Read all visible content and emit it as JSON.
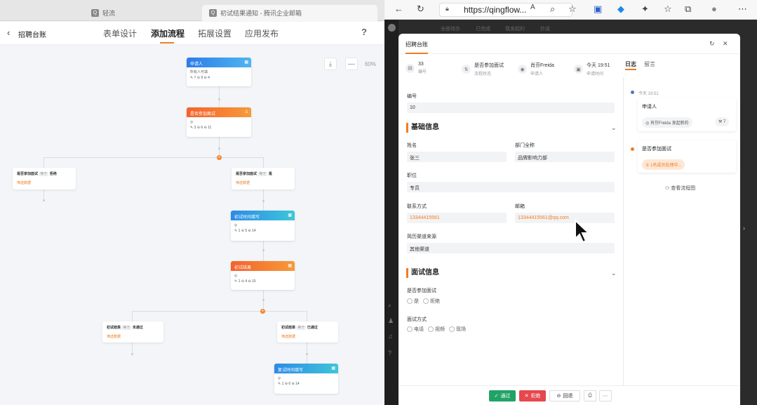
{
  "left_browser": {
    "tabs": [
      {
        "label": "轻流",
        "favicon": "Q"
      },
      {
        "label": "初试结果通知 - 腾讯企业邮箱",
        "favicon": "Q"
      }
    ]
  },
  "app": {
    "title": "招聘台账",
    "nav_tabs": [
      "表单设计",
      "添加流程",
      "拓展设置",
      "应用发布"
    ],
    "help": "?",
    "zoom": "60%"
  },
  "flow": {
    "applicant": {
      "title": "申请人",
      "body": "所有人可填",
      "meta": "7 ⊖ 9 ⊖ 4"
    },
    "interview": {
      "title": "是否参加面试",
      "meta": "3 ⊖ 6 ⊖ 11"
    },
    "cond_left": {
      "field": "是否参加面试",
      "op": "等于",
      "value": "拒绝",
      "link": "筛选数据"
    },
    "cond_right": {
      "field": "是否参加面试",
      "op": "等于",
      "value": "是",
      "link": "筛选数据"
    },
    "first_time": {
      "title": "初试时间填写",
      "meta": "1 ⊖ 5 ⊖ 14"
    },
    "first_result": {
      "title": "初试结果",
      "meta": "1 ⊖ 4 ⊖ 15"
    },
    "cond3": {
      "field": "初试结果",
      "op": "等于",
      "value": "未通过",
      "link": "筛选数据"
    },
    "cond4": {
      "field": "初试结果",
      "op": "等于",
      "value": "已通过",
      "link": "筛选数据"
    },
    "second_time": {
      "title": "复试时间填写",
      "meta": "1 ⊖ 6 ⊖ 14"
    }
  },
  "right_browser": {
    "url": "https://qingflow...",
    "dark_nav": [
      "全部待办",
      "已完成",
      "我发起的",
      "抄送"
    ]
  },
  "modal": {
    "title": "招聘台账",
    "info": [
      {
        "icon": "▤",
        "value": "33",
        "label": "编号"
      },
      {
        "icon": "⇅",
        "value": "是否参加面试",
        "label": "流程状态"
      },
      {
        "icon": "◉",
        "value": "肖芬Freida",
        "label": "申请人"
      },
      {
        "icon": "▣",
        "value": "今天 19:51",
        "label": "申请时间"
      }
    ],
    "number_label": "编号",
    "number_value": "10",
    "section1": "基础信息",
    "name_label": "姓名",
    "name_value": "张三",
    "dept_label": "部门全称",
    "dept_value": "品牌影响力部",
    "position_label": "职位",
    "position_value": "专员",
    "contact_label": "联系方式",
    "contact_value": "13344415561",
    "email_label": "邮箱",
    "email_value": "13344415561@qq.com",
    "source_label": "简历渠道来源",
    "source_value": "其他渠道",
    "section2": "面试信息",
    "attend_label": "是否参加面试",
    "attend_options": [
      "是",
      "拒绝"
    ],
    "method_label": "面试方式",
    "method_options": [
      "电话",
      "视频",
      "现场"
    ],
    "side_tabs": [
      "日志",
      "留言"
    ],
    "timeline": {
      "time": "今天 19:51",
      "step1": "申请人",
      "step1_chip": "肖芬Freida 发起新的",
      "step1_count": "7",
      "step2": "是否参加面试",
      "step2_chip": "1名成员处理中...",
      "view_flow": "查看流程图"
    },
    "buttons": {
      "pass": "通过",
      "reject": "拒绝",
      "back": "回退"
    }
  }
}
